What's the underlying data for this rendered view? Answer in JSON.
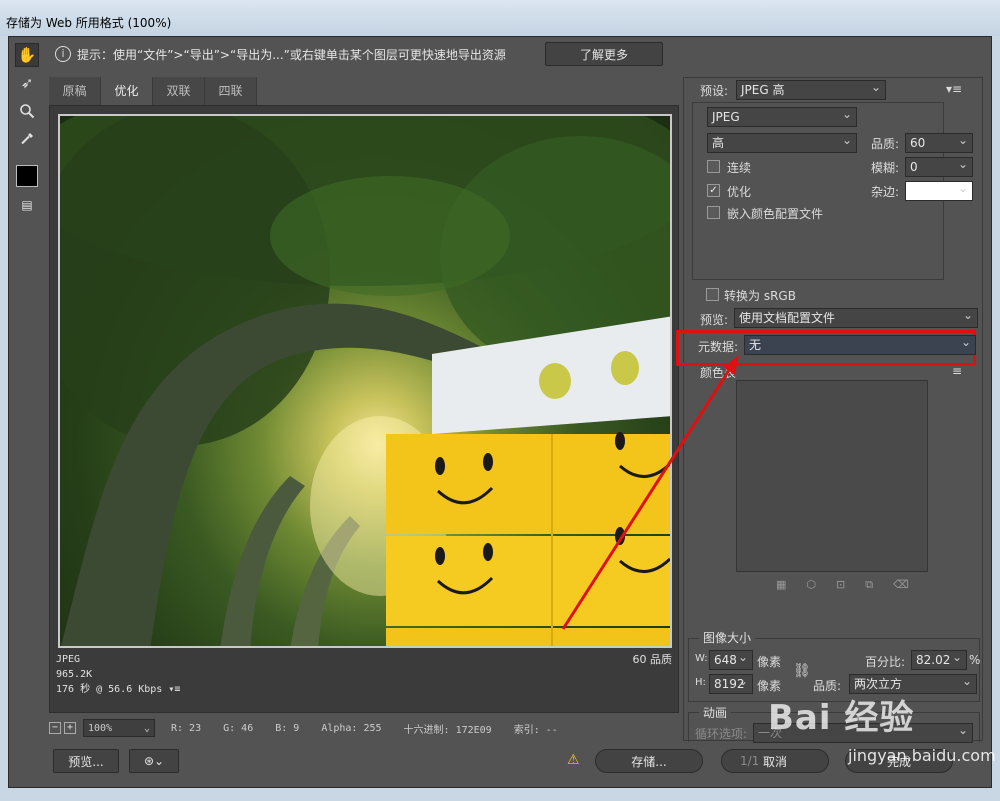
{
  "window": {
    "title": "存储为 Web 所用格式 (100%)"
  },
  "toolbar": {
    "tools": [
      "hand-icon",
      "slice-select-icon",
      "zoom-icon",
      "eyedropper-icon"
    ],
    "color_swatch": "#000000"
  },
  "hint": {
    "text": "提示：使用“文件”>“导出”>“导出为...”或右键单击某个图层可更快速地导出资源",
    "learn_more": "了解更多"
  },
  "tabs": [
    "原稿",
    "优化",
    "双联",
    "四联"
  ],
  "active_tab": "优化",
  "preview_info": {
    "format": "JPEG",
    "size": "965.2K",
    "time": "176 秒 @ 56.6 Kbps",
    "menu_glyph": "▾≡",
    "quality": "60 品质"
  },
  "status": {
    "zoom": "100%",
    "r": "R: 23",
    "g": "G: 46",
    "b": "B: 9",
    "alpha": "Alpha: 255",
    "hex": "十六进制: 172E09",
    "index": "索引: --"
  },
  "settings": {
    "preset_label": "预设:",
    "preset_value": "JPEG 高",
    "format_value": "JPEG",
    "quality_level": "高",
    "quality_label": "品质:",
    "quality_value": "60",
    "progressive_label": "连续",
    "blur_label": "模糊:",
    "blur_value": "0",
    "optimized_label": "优化",
    "optimized_checked": true,
    "matte_label": "杂边:",
    "embed_profile_label": "嵌入颜色配置文件",
    "convert_srgb_label": "转换为 sRGB",
    "preview_label": "预览:",
    "preview_value": "使用文档配置文件",
    "metadata_label": "元数据:",
    "metadata_value": "无",
    "color_table_label": "颜色表"
  },
  "image_size": {
    "title": "图像大小",
    "w_label": "W:",
    "w_value": "648",
    "w_unit": "像素",
    "h_label": "H:",
    "h_value": "8192",
    "h_unit": "像素",
    "percent_label": "百分比:",
    "percent_value": "82.02",
    "percent_unit": "%",
    "quality_label": "品质:",
    "quality_value": "两次立方"
  },
  "animation": {
    "title": "动画",
    "loop_label": "循环选项:",
    "loop_value": "一次",
    "frame": "1/1"
  },
  "buttons": {
    "preview": "预览...",
    "help": "?",
    "save": "存储...",
    "cancel": "取消",
    "done": "完成"
  },
  "watermark": {
    "logo": "Bai 经验",
    "site": "jingyan.baidu.com"
  },
  "colors": {
    "annotation_red": "#e01010",
    "panel_bg": "#535353",
    "tissue_yellow": "#f3c51a"
  }
}
